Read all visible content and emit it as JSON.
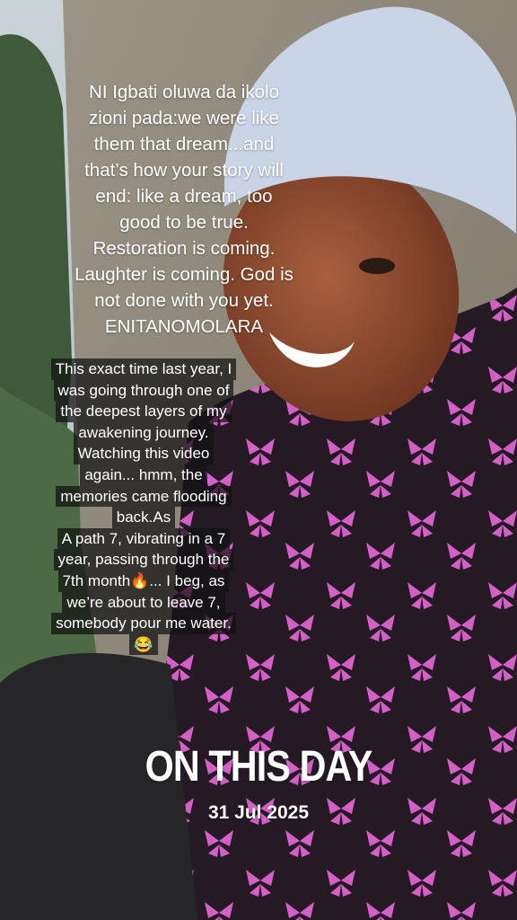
{
  "overlay": {
    "lines": [
      "NI Igbati oluwa da ikolo",
      "zioni pada:we were like",
      "them that dream...and",
      "that’s how your story will",
      "end: like a dream, too",
      "good to be true.",
      "Restoration is coming.",
      "Laughter is coming. God is",
      "not done with you yet.",
      "ENITANOMOLARA"
    ]
  },
  "caption": {
    "lines": [
      "This exact time last year, I",
      "was going through one of",
      "the deepest layers of my",
      "awakening journey.",
      "Watching this video",
      "again... hmm, the",
      "memories came flooding",
      "back.As",
      "A path 7, vibrating in a 7",
      "year, passing through the",
      "7th month🔥... I beg, as",
      "we’re about to leave 7,",
      "somebody pour me water.",
      "😂"
    ]
  },
  "memory": {
    "title": "ON THIS DAY",
    "date": "31 Jul 2025"
  },
  "colors": {
    "caption_bg": "#121212",
    "text": "#ffffff",
    "headwrap": "#c9d4e6",
    "shirt_dark": "#241a24",
    "butterfly_pink": "#d65ec8"
  }
}
